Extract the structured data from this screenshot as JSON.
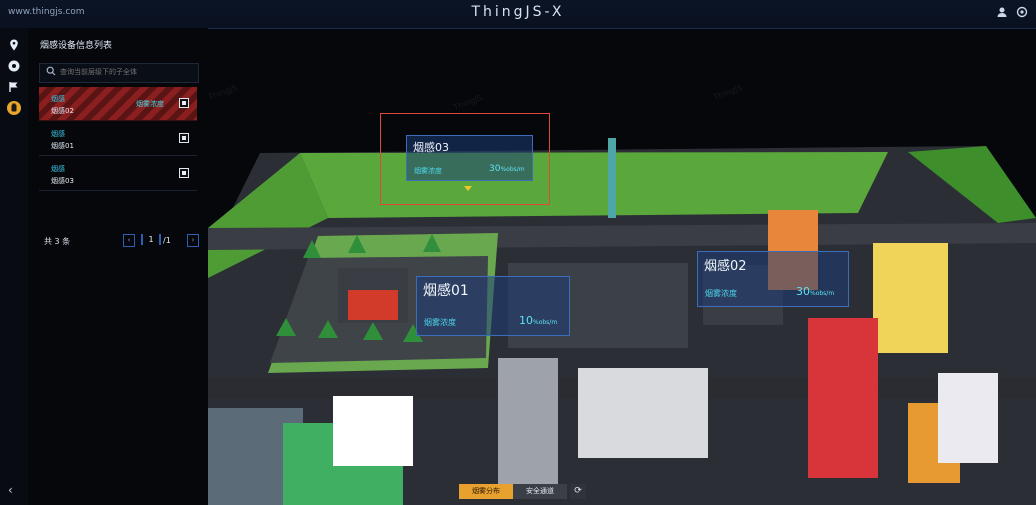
{
  "topbar": {
    "url": "www.thingjs.com",
    "title": "ThingJS-X",
    "icons": [
      "user-icon",
      "settings-icon"
    ]
  },
  "leftbar": {
    "icons": [
      "location-pin-icon",
      "compass-icon",
      "flag-icon",
      "alarm-icon"
    ],
    "collapse": "‹"
  },
  "panel": {
    "title": "烟感设备信息列表",
    "search": {
      "placeholder": "查询当前层级下的子全体",
      "value": ""
    },
    "items": [
      {
        "type": "烟感",
        "name": "烟感02",
        "status": "烟雾浓度",
        "checked": true
      },
      {
        "type": "烟感",
        "name": "烟感01",
        "status": "",
        "checked": true
      },
      {
        "type": "烟感",
        "name": "烟感03",
        "status": "",
        "checked": true
      }
    ],
    "pager": {
      "total": "共 3 条",
      "prev": "‹",
      "current": "1",
      "total_pages": "/1",
      "next": "›"
    }
  },
  "scene": {
    "popups": [
      {
        "title": "烟感03",
        "label": "烟雾浓度",
        "value": "30",
        "unit": "%obs/m"
      },
      {
        "title": "烟感02",
        "label": "烟雾浓度",
        "value": "30",
        "unit": "%obs/m"
      },
      {
        "title": "烟感01",
        "label": "烟雾浓度",
        "value": "10",
        "unit": "%obs/m"
      }
    ],
    "watermark": "ThingJS"
  },
  "bottom_tabs": {
    "tab1": "烟雾分布",
    "tab2": "安全通道",
    "refresh": "⟳"
  },
  "colors": {
    "accent_orange": "#e8a12f",
    "popup_cyan": "#5fe2f2",
    "selected_red": "#8b1f1f",
    "highlight_box": "#e2473b"
  }
}
